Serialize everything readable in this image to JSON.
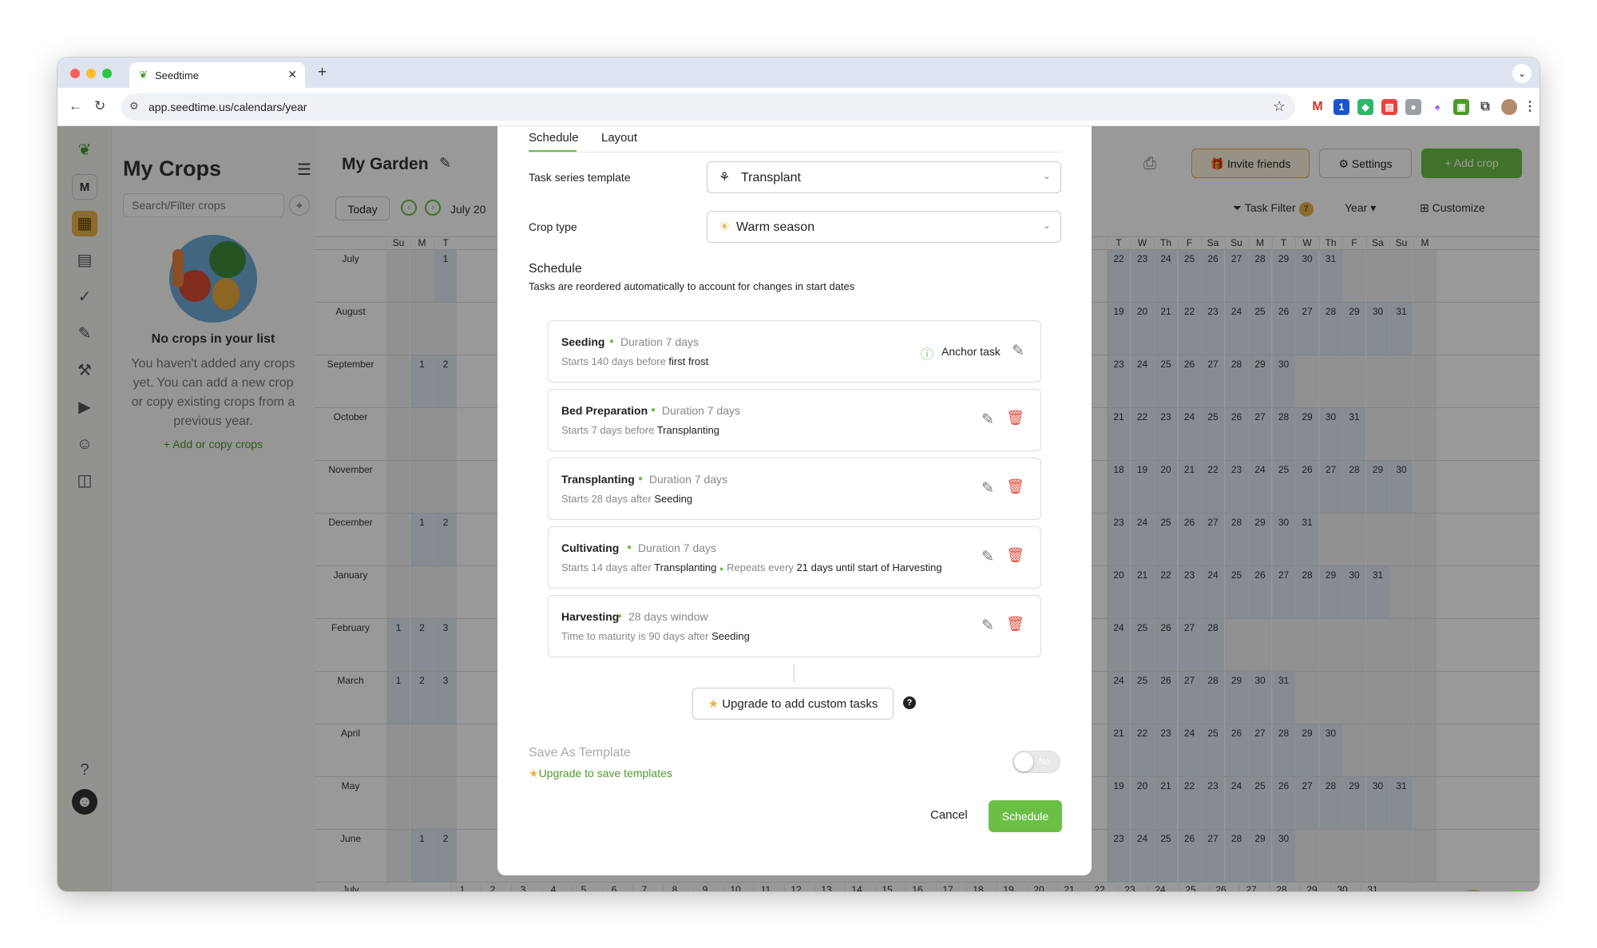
{
  "browser": {
    "tab_title": "Seedtime",
    "url": "app.seedtime.us/calendars/year",
    "extensions_badge": "1"
  },
  "sidebar": {
    "avatar_letter": "M",
    "title": "My Crops",
    "search_placeholder": "Search/Filter crops",
    "empty_title": "No crops in your list",
    "empty_text": "You haven't added any crops yet. You can add a new crop or copy existing crops from a previous year.",
    "add_link": "Add or copy crops"
  },
  "calendar": {
    "garden_title": "My Garden",
    "today_button": "Today",
    "current_label": "July 20",
    "invite_button": "Invite friends",
    "settings_button": "Settings",
    "add_crop_button": "Add crop",
    "task_filter": "Task Filter",
    "task_filter_count": "7",
    "view_select": "Year",
    "customize": "Customize",
    "weekday_left": [
      "Su",
      "M",
      "T"
    ],
    "weekday_right": [
      "T",
      "W",
      "Th",
      "F",
      "Sa",
      "Su",
      "M",
      "T",
      "W",
      "Th",
      "F",
      "Sa",
      "Su",
      "M"
    ],
    "months": [
      {
        "name": "July",
        "left": [
          "",
          "",
          "1"
        ],
        "right": [
          "22",
          "23",
          "24",
          "25",
          "26",
          "27",
          "28",
          "29",
          "30",
          "31",
          "",
          "",
          "",
          ""
        ]
      },
      {
        "name": "August",
        "left": [
          "",
          "",
          ""
        ],
        "right": [
          "19",
          "20",
          "21",
          "22",
          "23",
          "24",
          "25",
          "26",
          "27",
          "28",
          "29",
          "30",
          "31",
          ""
        ]
      },
      {
        "name": "September",
        "left": [
          "",
          "1",
          "2"
        ],
        "right": [
          "23",
          "24",
          "25",
          "26",
          "27",
          "28",
          "29",
          "30",
          "",
          "",
          "",
          "",
          "",
          ""
        ]
      },
      {
        "name": "October",
        "left": [
          "",
          "",
          ""
        ],
        "right": [
          "21",
          "22",
          "23",
          "24",
          "25",
          "26",
          "27",
          "28",
          "29",
          "30",
          "31",
          "",
          "",
          ""
        ]
      },
      {
        "name": "November",
        "left": [
          "",
          "",
          ""
        ],
        "right": [
          "18",
          "19",
          "20",
          "21",
          "22",
          "23",
          "24",
          "25",
          "26",
          "27",
          "28",
          "29",
          "30",
          ""
        ]
      },
      {
        "name": "December",
        "left": [
          "",
          "1",
          "2"
        ],
        "right": [
          "23",
          "24",
          "25",
          "26",
          "27",
          "28",
          "29",
          "30",
          "31",
          "",
          "",
          "",
          "",
          ""
        ]
      },
      {
        "name": "January",
        "left": [
          "",
          "",
          ""
        ],
        "right": [
          "20",
          "21",
          "22",
          "23",
          "24",
          "25",
          "26",
          "27",
          "28",
          "29",
          "30",
          "31",
          "",
          ""
        ]
      },
      {
        "name": "February",
        "left": [
          "1",
          "2",
          "3"
        ],
        "right": [
          "24",
          "25",
          "26",
          "27",
          "28",
          "",
          "",
          "",
          "",
          "",
          "",
          "",
          "",
          ""
        ]
      },
      {
        "name": "March",
        "left": [
          "1",
          "2",
          "3"
        ],
        "right": [
          "24",
          "25",
          "26",
          "27",
          "28",
          "29",
          "30",
          "31",
          "",
          "",
          "",
          "",
          "",
          ""
        ]
      },
      {
        "name": "April",
        "left": [
          "",
          "",
          ""
        ],
        "right": [
          "21",
          "22",
          "23",
          "24",
          "25",
          "26",
          "27",
          "28",
          "29",
          "30",
          "",
          "",
          "",
          ""
        ]
      },
      {
        "name": "May",
        "left": [
          "",
          "",
          ""
        ],
        "right": [
          "19",
          "20",
          "21",
          "22",
          "23",
          "24",
          "25",
          "26",
          "27",
          "28",
          "29",
          "30",
          "31",
          ""
        ]
      },
      {
        "name": "June",
        "left": [
          "",
          "1",
          "2"
        ],
        "right": [
          "23",
          "24",
          "25",
          "26",
          "27",
          "28",
          "29",
          "30",
          "",
          "",
          "",
          "",
          "",
          ""
        ]
      }
    ],
    "last_month": "July",
    "last_row": [
      "1",
      "2",
      "3",
      "4",
      "5",
      "6",
      "7",
      "8",
      "9",
      "10",
      "11",
      "12",
      "13",
      "14",
      "15",
      "16",
      "17",
      "18",
      "19",
      "20",
      "21",
      "22",
      "23",
      "24",
      "25",
      "26",
      "27",
      "28",
      "29",
      "30",
      "31"
    ]
  },
  "modal": {
    "tabs": [
      "Schedule",
      "Layout"
    ],
    "template_label": "Task series template",
    "template_value": "Transplant",
    "crop_type_label": "Crop type",
    "crop_type_value": "Warm season",
    "schedule_title": "Schedule",
    "schedule_subtitle": "Tasks are reordered automatically to account for changes in start dates",
    "tasks": [
      {
        "name": "Seeding",
        "detail": "Duration 7 days",
        "line_a": "Starts 140 days before ",
        "line_b": "first frost",
        "line_c": "",
        "line_d": "",
        "anchor": "Anchor task"
      },
      {
        "name": "Bed Preparation",
        "detail": "Duration 7 days",
        "line_a": "Starts 7 days before ",
        "line_b": "Transplanting",
        "line_c": "",
        "line_d": ""
      },
      {
        "name": "Transplanting",
        "detail": "Duration 7 days",
        "line_a": "Starts 28 days after ",
        "line_b": "Seeding",
        "line_c": "",
        "line_d": ""
      },
      {
        "name": "Cultivating",
        "detail": "Duration 7 days",
        "line_a": "Starts 14 days after ",
        "line_b": "Transplanting",
        "line_c": "Repeats every ",
        "line_d": "21 days until start of Harvesting"
      },
      {
        "name": "Harvesting",
        "detail": "28 days window",
        "line_a": "Time to maturity is 90 days after ",
        "line_b": "Seeding",
        "line_c": "",
        "line_d": ""
      }
    ],
    "upgrade_tasks_button": "Upgrade to add custom tasks",
    "save_template_label": "Save As Template",
    "upgrade_templates_link": "Upgrade to save templates",
    "toggle_value": "No",
    "cancel_button": "Cancel",
    "schedule_button": "Schedule"
  }
}
